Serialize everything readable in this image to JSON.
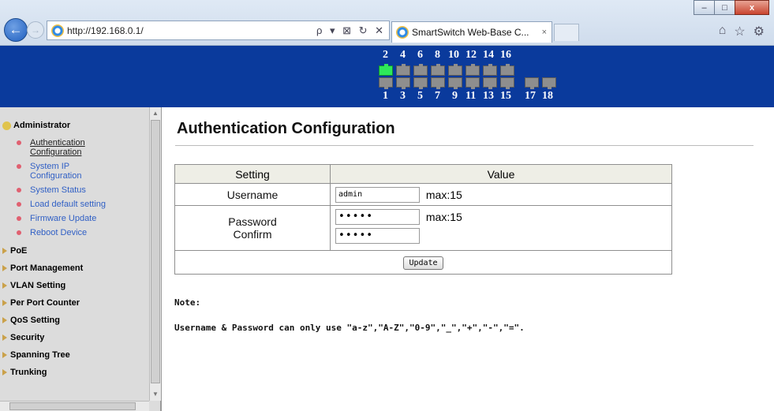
{
  "browser": {
    "url": "http://192.168.0.1/",
    "tab_title": "SmartSwitch Web-Base C...",
    "tab_close": "×",
    "address_tools": "ρ ▾ ⊠ ↻ ✕",
    "window_controls": {
      "minimize": "–",
      "maximize": "□",
      "close": "x"
    },
    "icons": [
      "back-arrow-icon",
      "forward-arrow-icon",
      "ie-icon",
      "home-icon",
      "star-icon",
      "gear-icon"
    ]
  },
  "ports": {
    "top_labels": [
      "2",
      "4",
      "6",
      "8",
      "10",
      "12",
      "14",
      "16"
    ],
    "bottom_labels": [
      "1",
      "3",
      "5",
      "7",
      "9",
      "11",
      "13",
      "15",
      "17",
      "18"
    ],
    "active_ports": [
      "2"
    ],
    "active_color": "#2ee85a",
    "header_color": "#0a3a9c"
  },
  "sidebar": {
    "administrator": {
      "title": "Administrator",
      "items": [
        {
          "label": "Authentication Configuration",
          "current": true
        },
        {
          "label": "System IP Configuration"
        },
        {
          "label": "System Status"
        },
        {
          "label": "Load default setting"
        },
        {
          "label": "Firmware Update"
        },
        {
          "label": "Reboot Device"
        }
      ]
    },
    "sections": [
      "PoE",
      "Port Management",
      "VLAN Setting",
      "Per Port Counter",
      "QoS Setting",
      "Security",
      "Spanning Tree",
      "Trunking"
    ]
  },
  "main": {
    "title": "Authentication Configuration",
    "table": {
      "col_setting": "Setting",
      "col_value": "Value",
      "username_label": "Username",
      "username_value": "admin",
      "username_max": "max:15",
      "password_label": "Password",
      "confirm_label": "Confirm",
      "password_value": "•••••",
      "confirm_value": "•••••",
      "password_max": "max:15",
      "update_label": "Update"
    },
    "note_title": "Note:",
    "note_text": "Username & Password can only use \"a-z\",\"A-Z\",\"0-9\",\"_\",\"+\",\"-\",\"=\"."
  }
}
